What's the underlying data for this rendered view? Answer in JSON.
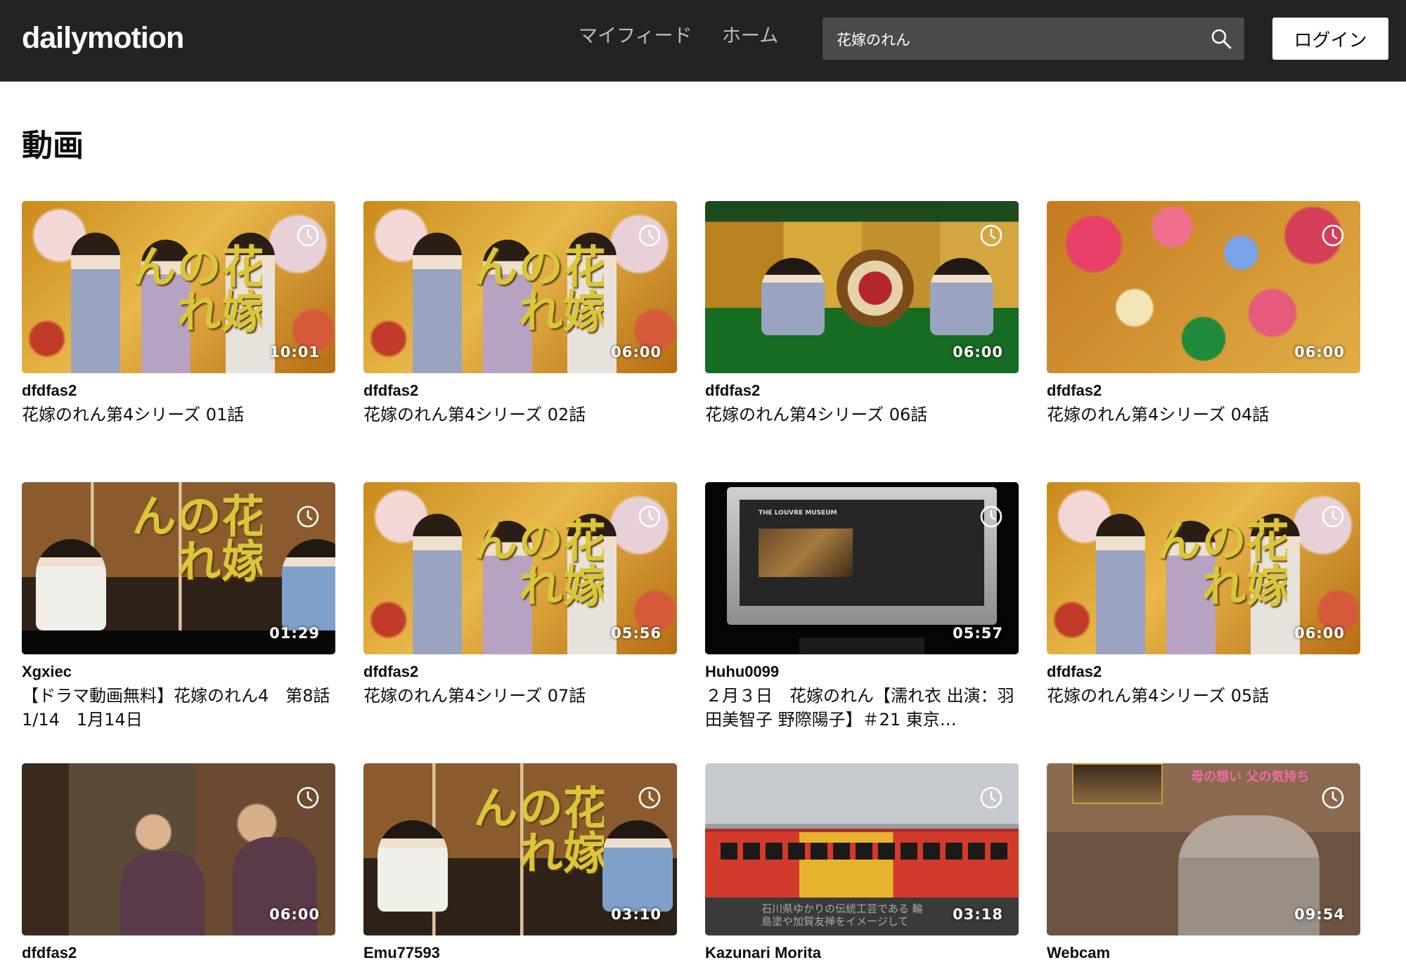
{
  "header": {
    "logo": "dailymotion",
    "nav": [
      "マイフィード",
      "ホーム"
    ],
    "search_value": "花嫁のれん",
    "login_label": "ログイン"
  },
  "section_title": "動画",
  "videos": [
    {
      "owner": "dfdfas2",
      "title": "花嫁のれん第4シリーズ 01話",
      "duration": "10:01",
      "thumb_text": "花嫁のれん"
    },
    {
      "owner": "dfdfas2",
      "title": "花嫁のれん第4シリーズ 02話",
      "duration": "06:00",
      "thumb_text": "花嫁のれん"
    },
    {
      "owner": "dfdfas2",
      "title": "花嫁のれん第4シリーズ 06話",
      "duration": "06:00",
      "thumb_text": ""
    },
    {
      "owner": "dfdfas2",
      "title": "花嫁のれん第4シリーズ 04話",
      "duration": "06:00",
      "thumb_text": ""
    },
    {
      "owner": "Xgxiec",
      "title": "【ドラマ動画無料】花嫁のれん4　第8話　1/14　1月14日",
      "duration": "01:29",
      "thumb_text": "花嫁のれん"
    },
    {
      "owner": "dfdfas2",
      "title": "花嫁のれん第4シリーズ 07話",
      "duration": "05:56",
      "thumb_text": "花嫁のれん"
    },
    {
      "owner": "Huhu0099",
      "title": "２月３日　花嫁のれん【濡れ衣 出演：羽田美智子 野際陽子】＃21 東京…",
      "duration": "05:57",
      "thumb_text": "THE LOUVRE MUSEUM"
    },
    {
      "owner": "dfdfas2",
      "title": "花嫁のれん第4シリーズ 05話",
      "duration": "06:00",
      "thumb_text": "花嫁のれん"
    },
    {
      "owner": "dfdfas2",
      "title": "",
      "duration": "06:00",
      "thumb_text": ""
    },
    {
      "owner": "Emu77593",
      "title": "",
      "duration": "03:10",
      "thumb_text": "花嫁のれん"
    },
    {
      "owner": "Kazunari Morita",
      "title": "",
      "duration": "03:18",
      "thumb_text": "石川県ゆかりの伝統工芸である 輪島塗や加賀友禅をイメージして"
    },
    {
      "owner": "Webcam",
      "title": "",
      "duration": "09:54",
      "thumb_text": "母の想い 父の気持ち"
    }
  ],
  "colors": {
    "header_bg": "#232323",
    "search_bg": "#4a4a4a",
    "nav_text": "#bdbdbd"
  }
}
